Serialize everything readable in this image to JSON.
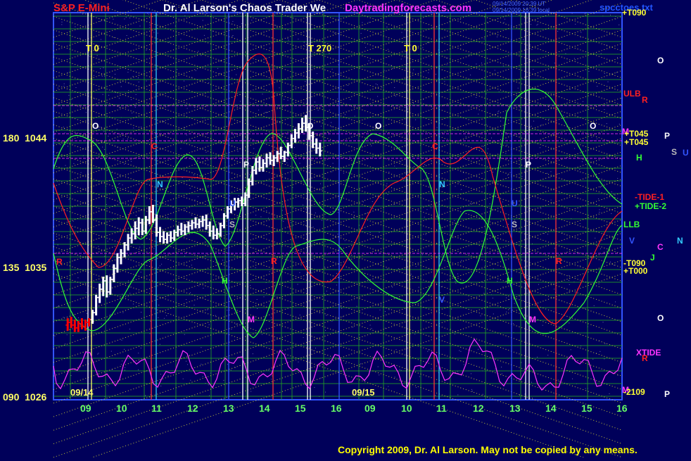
{
  "header": {
    "instrument": "S&P E-Mini",
    "title": "Dr. Al Larson's Chaos Trader We",
    "website": "Daytradingforecasts.com",
    "timestamp_1": "09/14/2009 20:39 UT",
    "timestamp_2": "09/14/2009 16:39 local",
    "filename": "spcctoes.txt"
  },
  "colors": {
    "background": "#00005a",
    "accent_red": "#ff2020",
    "accent_magenta": "#ff33ff",
    "grid_green": "#22aa22",
    "grid_yellow": "#dddd33",
    "bar_white": "#ffffff",
    "bar_red": "#ff0000"
  },
  "y_axis": [
    {
      "angle": "180",
      "price": "1044"
    },
    {
      "angle": "135",
      "price": "1035"
    },
    {
      "angle": "090",
      "price": "1026"
    }
  ],
  "x_axis": [
    "09",
    "10",
    "11",
    "12",
    "13",
    "14",
    "15",
    "16",
    "09",
    "10",
    "11",
    "12",
    "13",
    "14",
    "15",
    "16"
  ],
  "dates": [
    "09/14",
    "09/15"
  ],
  "cycle_labels": [
    "T 0",
    "T 270",
    "T 0"
  ],
  "right_labels": [
    {
      "text": "+T090",
      "color": "#ffff33"
    },
    {
      "text": "ULB",
      "color": "#ff2020"
    },
    {
      "text": "R",
      "color": "#ff2020"
    },
    {
      "text": "M",
      "color": "#ff33ff"
    },
    {
      "text": "+T045",
      "color": "#ffff33"
    },
    {
      "text": "+T045",
      "color": "#ffff33"
    },
    {
      "text": "P",
      "color": "#ffffff"
    },
    {
      "text": "H",
      "color": "#33ff33"
    },
    {
      "text": "S",
      "color": "#bbbbbb"
    },
    {
      "text": "U",
      "color": "#3355ff"
    },
    {
      "text": "-TIDE-1",
      "color": "#ff2020"
    },
    {
      "text": "+TIDE-2",
      "color": "#33ff33"
    },
    {
      "text": "LLB",
      "color": "#33ff33"
    },
    {
      "text": "V",
      "color": "#3355ff"
    },
    {
      "text": "C",
      "color": "#ff33ff"
    },
    {
      "text": "N",
      "color": "#33ccff"
    },
    {
      "text": "J",
      "color": "#33ff33"
    },
    {
      "text": "-T090",
      "color": "#ffff33"
    },
    {
      "text": "+T000",
      "color": "#ffff33"
    },
    {
      "text": "O",
      "color": "#ffffff"
    },
    {
      "text": "O",
      "color": "#ffffff"
    },
    {
      "text": "XTIDE",
      "color": "#ff33ff"
    },
    {
      "text": "R",
      "color": "#ff2020"
    },
    {
      "text": "M",
      "color": "#ff33ff"
    },
    {
      "text": "-2109",
      "color": "#ffff33"
    },
    {
      "text": "P",
      "color": "#ffffff"
    }
  ],
  "field_labels": [
    {
      "text": "O",
      "color": "#ffffff"
    },
    {
      "text": "C",
      "color": "#ff2020"
    },
    {
      "text": "N",
      "color": "#33ccff"
    },
    {
      "text": "R",
      "color": "#ff2020"
    },
    {
      "text": "P",
      "color": "#ffffff"
    },
    {
      "text": "U",
      "color": "#3355ff"
    },
    {
      "text": "S",
      "color": "#bbbbbb"
    },
    {
      "text": "H",
      "color": "#33ff33"
    },
    {
      "text": "R",
      "color": "#ff2020"
    },
    {
      "text": "M",
      "color": "#ff33ff"
    },
    {
      "text": "O",
      "color": "#ffffff"
    },
    {
      "text": "O",
      "color": "#ffffff"
    },
    {
      "text": "C",
      "color": "#ff2020"
    },
    {
      "text": "N",
      "color": "#33ccff"
    },
    {
      "text": "P",
      "color": "#ffffff"
    },
    {
      "text": "U",
      "color": "#3355ff"
    },
    {
      "text": "S",
      "color": "#bbbbbb"
    },
    {
      "text": "H",
      "color": "#33ff33"
    },
    {
      "text": "R",
      "color": "#ff2020"
    },
    {
      "text": "M",
      "color": "#ff33ff"
    },
    {
      "text": "O",
      "color": "#ffffff"
    },
    {
      "text": "V",
      "color": "#3355ff"
    }
  ],
  "copyright": "Copyright 2009, Dr. Al Larson. May not be copied by any means.",
  "chart_data": {
    "type": "bar",
    "title": "",
    "ylim": [
      1025,
      1053
    ],
    "x": [
      8.9,
      9.0,
      9.1,
      9.2,
      9.3,
      9.4,
      9.5,
      9.6,
      9.7,
      9.8,
      9.9,
      10.0,
      10.1,
      10.2,
      10.3,
      10.4,
      10.5,
      10.6,
      10.7,
      10.8,
      10.9,
      11.0,
      11.1,
      11.2,
      11.3,
      11.4,
      11.5,
      11.6,
      11.7,
      11.8,
      11.9,
      12.0,
      12.1,
      12.2,
      12.3,
      12.4,
      12.5,
      12.6,
      12.7,
      12.8,
      12.9,
      13.0,
      13.1,
      13.2,
      13.3,
      13.4,
      13.5,
      13.6,
      13.7,
      13.8,
      13.9,
      14.0,
      14.1,
      14.2,
      14.3,
      14.4,
      14.5,
      14.6,
      14.7,
      14.8,
      14.9,
      15.0,
      15.1,
      15.2,
      15.3,
      15.4,
      15.5,
      15.6,
      15.7,
      15.8,
      15.9,
      16.0
    ],
    "series": [
      {
        "values": [
          [
            1030.4,
            1030.9,
            1030.0,
            1030.6
          ],
          [
            1030.6,
            1031.0,
            1030.2,
            1030.4
          ],
          [
            1030.4,
            1030.8,
            1029.9,
            1030.2
          ],
          [
            1030.2,
            1030.7,
            1029.9,
            1030.5
          ],
          [
            1030.5,
            1030.9,
            1030.1,
            1030.3
          ],
          [
            1030.3,
            1030.8,
            1030.0,
            1030.6
          ],
          [
            1030.6,
            1030.9,
            1030.3,
            1030.8
          ],
          [
            1030.8,
            1031.5,
            1030.5,
            1031.3
          ],
          [
            1031.3,
            1032.6,
            1031.1,
            1032.4
          ],
          [
            1032.4,
            1033.4,
            1032.0,
            1033.0
          ],
          [
            1033.0,
            1033.9,
            1032.5,
            1033.6
          ],
          [
            1033.6,
            1034.0,
            1032.4,
            1032.8
          ],
          [
            1032.8,
            1033.9,
            1032.6,
            1033.7
          ],
          [
            1033.7,
            1034.8,
            1033.5,
            1034.5
          ],
          [
            1034.5,
            1035.6,
            1034.2,
            1035.3
          ],
          [
            1035.3,
            1035.9,
            1034.8,
            1035.6
          ],
          [
            1035.6,
            1036.4,
            1035.3,
            1036.2
          ],
          [
            1036.2,
            1037.0,
            1035.8,
            1036.7
          ],
          [
            1036.7,
            1037.4,
            1036.3,
            1037.0
          ],
          [
            1037.0,
            1037.9,
            1036.6,
            1037.4
          ],
          [
            1037.4,
            1038.2,
            1036.9,
            1037.8
          ],
          [
            1037.8,
            1038.1,
            1036.9,
            1037.2
          ],
          [
            1037.2,
            1038.3,
            1037.0,
            1038.0
          ],
          [
            1038.0,
            1039.0,
            1037.7,
            1038.6
          ],
          [
            1038.6,
            1039.1,
            1037.8,
            1038.0
          ],
          [
            1038.0,
            1038.4,
            1036.8,
            1037.1
          ],
          [
            1037.1,
            1037.5,
            1036.4,
            1036.8
          ],
          [
            1036.8,
            1037.2,
            1036.3,
            1036.6
          ],
          [
            1036.6,
            1037.1,
            1036.3,
            1036.9
          ],
          [
            1036.9,
            1037.2,
            1036.4,
            1036.7
          ],
          [
            1036.7,
            1037.3,
            1036.5,
            1037.1
          ],
          [
            1037.1,
            1037.6,
            1036.8,
            1037.3
          ],
          [
            1037.3,
            1037.8,
            1036.9,
            1037.2
          ],
          [
            1037.2,
            1037.7,
            1036.9,
            1037.5
          ],
          [
            1037.5,
            1037.9,
            1037.1,
            1037.6
          ],
          [
            1037.6,
            1038.0,
            1037.3,
            1037.8
          ],
          [
            1037.8,
            1038.2,
            1037.4,
            1037.7
          ],
          [
            1037.7,
            1038.1,
            1037.4,
            1037.9
          ],
          [
            1037.9,
            1038.3,
            1037.5,
            1038.0
          ],
          [
            1038.0,
            1038.4,
            1037.3,
            1037.6
          ],
          [
            1037.6,
            1037.9,
            1036.8,
            1037.2
          ],
          [
            1037.2,
            1037.6,
            1036.6,
            1036.9
          ],
          [
            1036.9,
            1037.4,
            1036.6,
            1037.0
          ],
          [
            1037.0,
            1037.8,
            1036.8,
            1037.6
          ],
          [
            1037.6,
            1038.5,
            1037.4,
            1038.3
          ],
          [
            1038.3,
            1039.0,
            1038.1,
            1038.8
          ],
          [
            1038.8,
            1039.4,
            1038.5,
            1039.1
          ],
          [
            1039.1,
            1039.6,
            1038.7,
            1039.3
          ],
          [
            1039.3,
            1039.6,
            1038.9,
            1039.4
          ],
          [
            1039.4,
            1039.7,
            1039.0,
            1039.2
          ],
          [
            1039.2,
            1040.0,
            1039.0,
            1039.8
          ],
          [
            1039.8,
            1041.0,
            1039.6,
            1040.8
          ],
          [
            1040.8,
            1041.9,
            1040.5,
            1041.6
          ],
          [
            1041.6,
            1042.5,
            1041.3,
            1042.2
          ],
          [
            1042.2,
            1042.6,
            1041.5,
            1041.8
          ],
          [
            1041.8,
            1042.4,
            1041.5,
            1042.1
          ],
          [
            1042.1,
            1042.8,
            1041.8,
            1042.5
          ],
          [
            1042.5,
            1042.9,
            1042.0,
            1042.3
          ],
          [
            1042.3,
            1042.7,
            1041.9,
            1042.5
          ],
          [
            1042.5,
            1043.0,
            1042.2,
            1042.8
          ],
          [
            1042.8,
            1043.3,
            1042.4,
            1042.6
          ],
          [
            1042.6,
            1043.0,
            1042.2,
            1042.9
          ],
          [
            1042.9,
            1043.6,
            1042.6,
            1043.4
          ],
          [
            1043.4,
            1044.2,
            1043.2,
            1043.9
          ],
          [
            1043.9,
            1044.6,
            1043.6,
            1044.3
          ],
          [
            1044.3,
            1045.0,
            1043.9,
            1044.6
          ],
          [
            1044.6,
            1045.4,
            1044.3,
            1045.0
          ],
          [
            1045.0,
            1045.6,
            1044.4,
            1044.7
          ],
          [
            1044.7,
            1045.0,
            1043.8,
            1044.1
          ],
          [
            1044.1,
            1044.4,
            1043.2,
            1043.5
          ],
          [
            1043.5,
            1043.9,
            1042.8,
            1043.2
          ],
          [
            1043.2,
            1043.6,
            1042.6,
            1043.0
          ]
        ]
      }
    ]
  }
}
